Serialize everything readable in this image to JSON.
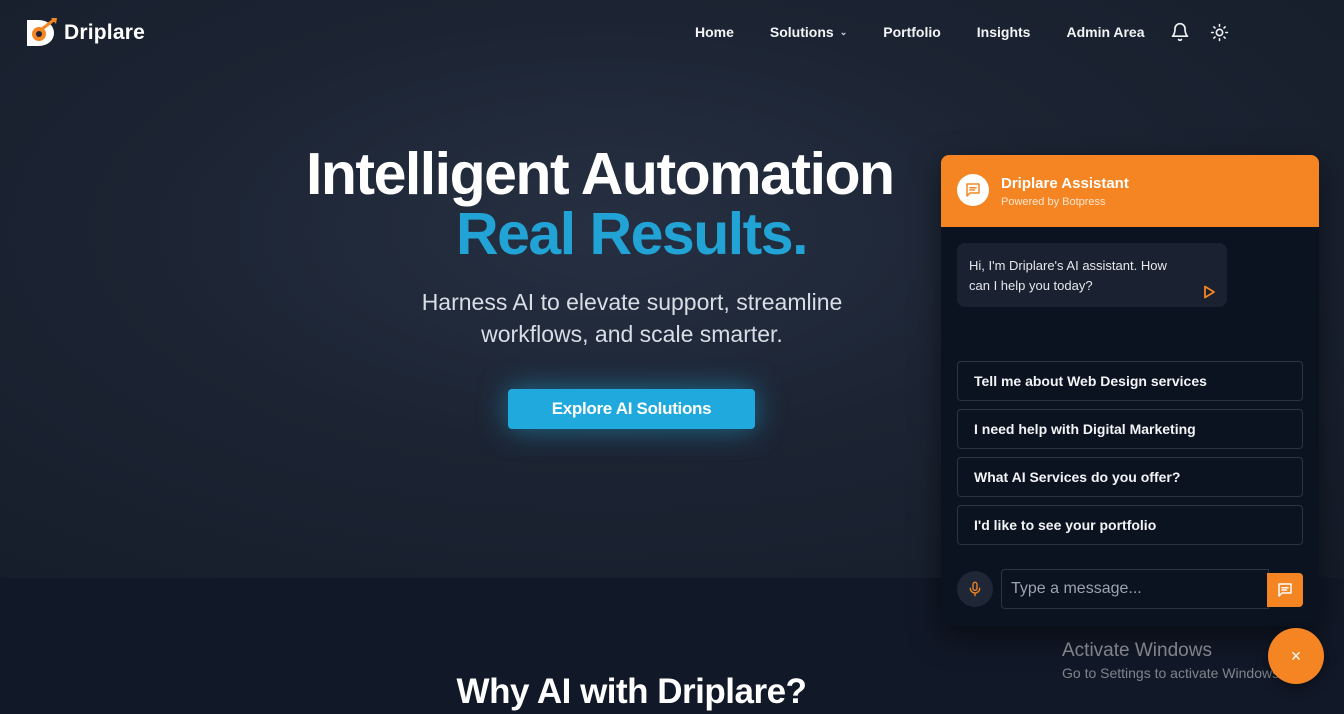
{
  "brand": {
    "name": "Driplare"
  },
  "nav": {
    "items": [
      "Home",
      "Solutions",
      "Portfolio",
      "Insights",
      "Admin Area"
    ],
    "solutions_has_dropdown": true,
    "icons": [
      "bell-icon",
      "sun-icon"
    ]
  },
  "hero": {
    "headline_line1": "Intelligent Automation",
    "headline_line2": "Real Results.",
    "subheadline": "Harness AI to elevate support, streamline workflows, and scale smarter.",
    "cta_label": "Explore AI Solutions"
  },
  "section": {
    "title": "Why AI with Driplare?"
  },
  "chat": {
    "title": "Driplare Assistant",
    "subtitle": "Powered by Botpress",
    "greeting": "Hi, I'm Driplare's AI assistant. How can I help you today?",
    "suggestions": [
      "Tell me about Web Design services",
      "I need help with Digital Marketing",
      "What AI Services do you offer?",
      "I'd like to see your portfolio"
    ],
    "input_placeholder": "Type a message...",
    "close_label": "×"
  },
  "watermark": {
    "line1": "Activate Windows",
    "line2": "Go to Settings to activate Windows."
  },
  "colors": {
    "accent_orange": "#f58523",
    "accent_blue": "#20a9dd",
    "background": "#111827"
  }
}
